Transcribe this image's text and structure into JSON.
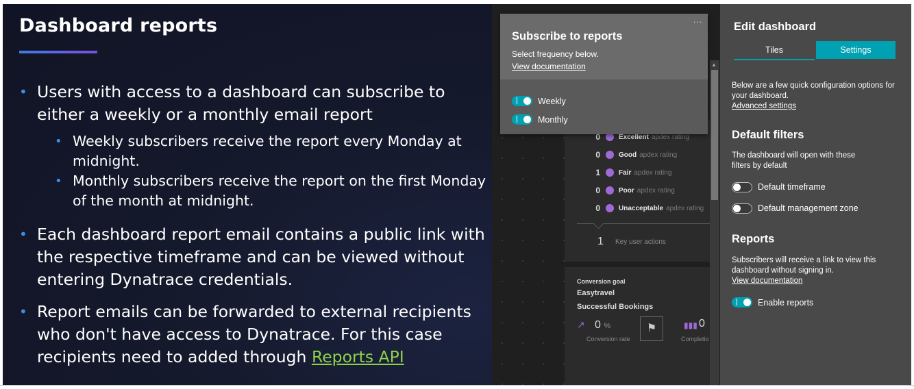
{
  "slide": {
    "title": "Dashboard reports",
    "bullet1": "Users with access to a dashboard can subscribe to either a weekly or a monthly email report",
    "bullet1_sub1": "Weekly subscribers receive the report every Monday at midnight.",
    "bullet1_sub2": "Monthly subscribers receive the report on the first Monday of the month at midnight.",
    "bullet2": "Each dashboard report email contains a public link with the respective timeframe and can be viewed without entering Dynatrace credentials.",
    "bullet3_text": "Report emails can be forwarded to external recipients who don't have access to Dynatrace. For this case recipients need to added through ",
    "bullet3_link": "Reports API",
    "bullet_symbol": "•",
    "accent_color": "#3a8ee6",
    "link_color": "#8dd24a"
  },
  "subscribe_popup": {
    "title": "Subscribe to reports",
    "subtitle": "Select frequency below.",
    "doc_link": "View documentation",
    "menu_icon": "...",
    "options": [
      {
        "label": "Weekly",
        "enabled": true
      },
      {
        "label": "Monthly",
        "enabled": true
      }
    ]
  },
  "apdex_tile": {
    "rows": [
      {
        "count": "0",
        "label": "Excellent",
        "sub": "apdex rating"
      },
      {
        "count": "0",
        "label": "Good",
        "sub": "apdex rating"
      },
      {
        "count": "1",
        "label": "Fair",
        "sub": "apdex rating"
      },
      {
        "count": "0",
        "label": "Poor",
        "sub": "apdex rating"
      },
      {
        "count": "0",
        "label": "Unacceptable",
        "sub": "apdex rating"
      }
    ],
    "key_actions_count": "1",
    "key_actions_label": "Key user actions"
  },
  "conversion_tile": {
    "label": "Conversion goal",
    "app": "Easytravel",
    "goal": "Successful Bookings",
    "rate_value": "0",
    "rate_unit": "%",
    "rate_label": "Conversion rate",
    "completions_value": "0",
    "completions_label": "Completio"
  },
  "edit_dashboard": {
    "title": "Edit dashboard",
    "tabs": [
      {
        "label": "Tiles",
        "active": false
      },
      {
        "label": "Settings",
        "active": true
      }
    ],
    "intro": "Below are a few quick configuration options for your dashboard.",
    "advanced_link": "Advanced settings",
    "filters_heading": "Default filters",
    "filters_text": "The dashboard will open with these filters by default",
    "filter_options": [
      {
        "label": "Default timeframe",
        "enabled": false
      },
      {
        "label": "Default management zone",
        "enabled": false
      }
    ],
    "reports_heading": "Reports",
    "reports_text": "Subscribers will receive a link to view this dashboard without signing in.",
    "reports_link": "View documentation",
    "enable_reports": {
      "label": "Enable reports",
      "enabled": true
    },
    "accent_color": "#00a1b2"
  }
}
